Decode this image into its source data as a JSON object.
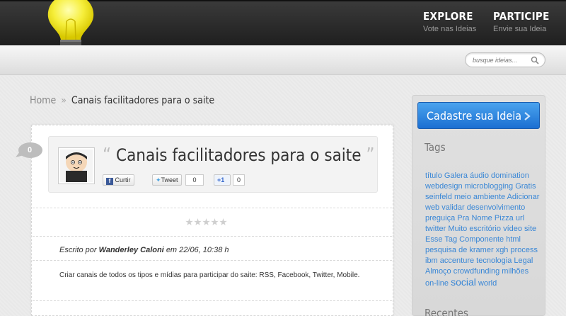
{
  "header": {
    "nav": [
      {
        "title": "EXPLORE",
        "subtitle": "Vote nas Ideias"
      },
      {
        "title": "PARTICIPE",
        "subtitle": "Envie sua Ideia"
      }
    ],
    "search": {
      "placeholder": "busque ideias..."
    }
  },
  "breadcrumb": {
    "home": "Home",
    "separator": "»",
    "current": "Canais facilitadores para o saite"
  },
  "post": {
    "comment_count": "0",
    "title_open_quote": "“",
    "title": "Canais facilitadores para o saite",
    "title_close_quote": "”",
    "share": {
      "facebook_label": "Curtir",
      "tweet_label": "Tweet",
      "tweet_count": "0",
      "plusone_label": "+1",
      "plusone_count": "0"
    },
    "rating_stars": 5,
    "byline_prefix": "Escrito por",
    "author": "Wanderley Caloni",
    "byline_suffix": "em 22/06, 10:38 h",
    "body": "Criar canais de todos os tipos e mídias para participar do saite: RSS, Facebook, Twitter, Mobile."
  },
  "sidebar": {
    "cta_label": "Cadastre sua Ideia",
    "tags_heading": "Tags",
    "tags": [
      "título",
      "Galera",
      "áudio",
      "domination",
      "webdesign",
      "microblogging",
      "Gratis",
      "seinfeld",
      "meio ambiente",
      "Adicionar",
      "web",
      "validar",
      "desenvolvimento",
      "preguiça",
      "Pra",
      "Nome",
      "Pizza",
      "url",
      "twitter",
      "Muito",
      "escritório",
      "vídeo",
      "site",
      "Esse",
      "Tag",
      "Componente",
      "html",
      "pesquisa de",
      "kramer",
      "xgh",
      "process",
      "ibm",
      "accenture",
      "tecnologia",
      "Legal",
      "Almoço",
      "crowdfunding",
      "milhões",
      "on-line",
      "social",
      "world"
    ],
    "recent_heading": "Recentes"
  },
  "colors": {
    "accent": "#3a87d6",
    "cta": "#1b6fd2",
    "header": "#2a2a2a"
  }
}
